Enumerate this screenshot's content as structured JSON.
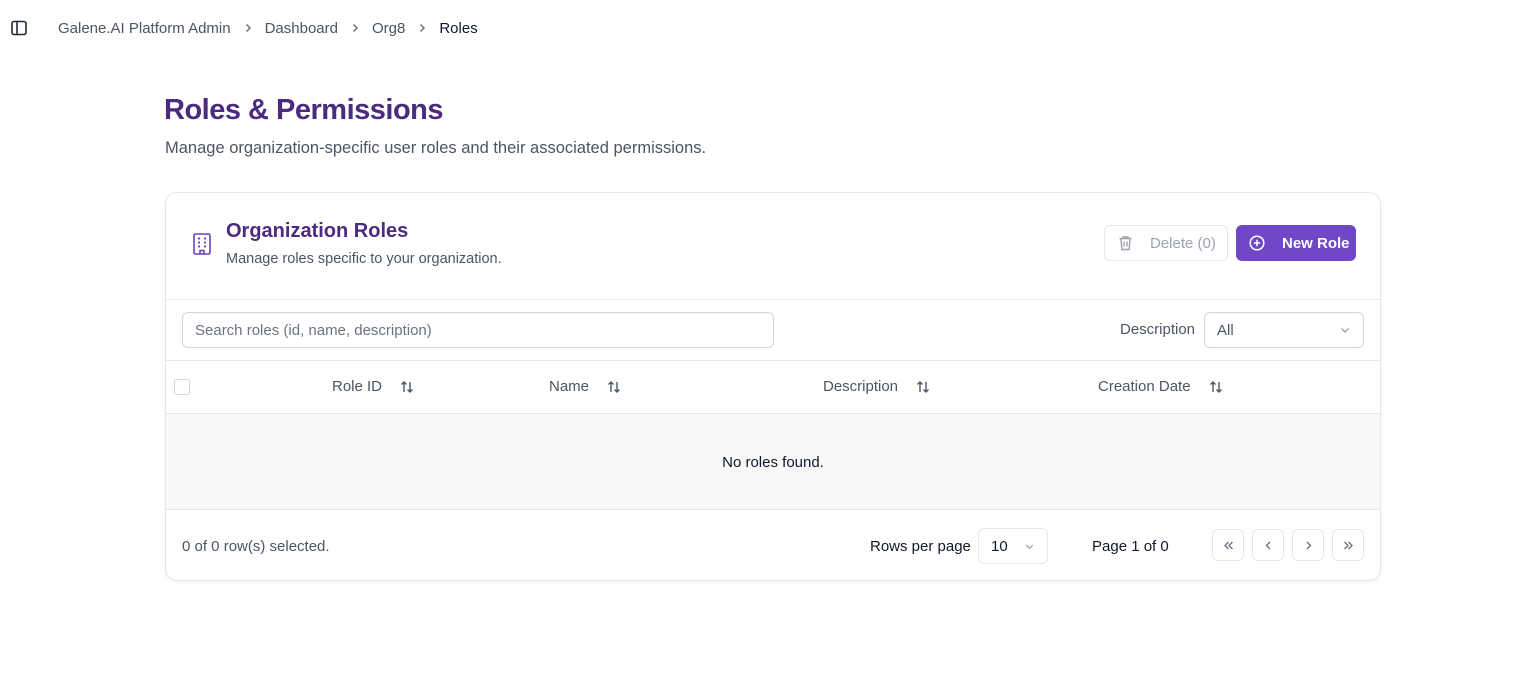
{
  "breadcrumb": {
    "items": [
      "Galene.AI Platform Admin",
      "Dashboard",
      "Org8",
      "Roles"
    ]
  },
  "page": {
    "title": "Roles & Permissions",
    "subtitle": "Manage organization-specific user roles and their associated permissions."
  },
  "card": {
    "title": "Organization Roles",
    "subtitle": "Manage roles specific to your organization.",
    "icon": "building-icon",
    "delete_label": "Delete (0)",
    "new_label": "New Role"
  },
  "filters": {
    "search_placeholder": "Search roles (id, name, description)",
    "search_value": "",
    "description_label": "Description",
    "description_value": "All"
  },
  "table": {
    "columns": [
      "Role ID",
      "Name",
      "Description",
      "Creation Date"
    ],
    "rows": [],
    "empty_text": "No roles found."
  },
  "footer": {
    "selected_text": "0 of 0 row(s) selected.",
    "rows_per_page_label": "Rows per page",
    "rows_per_page_value": "10",
    "page_info": "Page 1 of 0"
  },
  "colors": {
    "accent": "#7048c7",
    "title": "#4c2a7e"
  }
}
